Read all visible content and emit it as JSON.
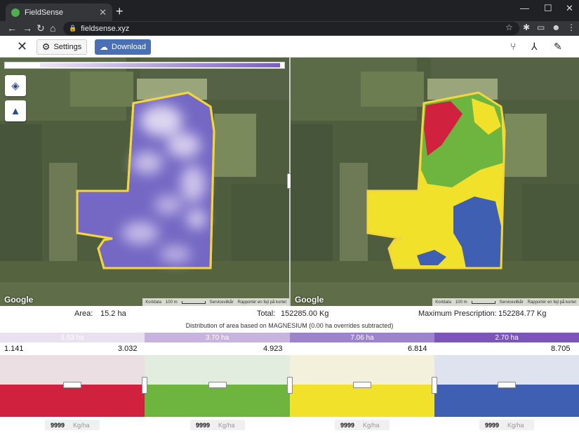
{
  "browser": {
    "tab_title": "FieldSense",
    "tab_close": "✕",
    "new_tab": "+",
    "url": "fieldsense.xyz",
    "win_min": "—",
    "win_max": "☐",
    "win_close": "✕"
  },
  "toolbar": {
    "close": "✕",
    "settings_label": "Settings",
    "download_label": "Download"
  },
  "map": {
    "google_label": "Google",
    "attribution_left": [
      "Kortdata",
      "100 m",
      "Servicevilkår",
      "Rapportér en fejl på kortet"
    ],
    "attribution_right": [
      "Kortdata",
      "100 m",
      "Servicevilkår",
      "Rapportér en fejl på kortet"
    ]
  },
  "stats": {
    "area_label": "Area:",
    "area_value": "15.2 ha",
    "total_label": "Total:",
    "total_value": "152285.00 Kg",
    "max_label": "Maximum Prescription:",
    "max_value": "152284.77 Kg"
  },
  "distribution": {
    "title": "Distribution of area based on MAGNESIUM (0.00 ha overrides subtracted)",
    "classes": [
      {
        "area": "1.63 ha",
        "color": "#e9e0f0",
        "text_color": "#ffffff",
        "top_color": "#ecdfe3",
        "bottom_color": "#d0213f",
        "qty": "9999",
        "unit": "Kg/ha"
      },
      {
        "area": "3.70 ha",
        "color": "#c7b3dd",
        "text_color": "#ffffff",
        "top_color": "#e2ede0",
        "bottom_color": "#6db53f",
        "qty": "9999",
        "unit": "Kg/ha"
      },
      {
        "area": "7.06 ha",
        "color": "#9d83cc",
        "text_color": "#ffffff",
        "top_color": "#f3f1dc",
        "bottom_color": "#f2e12a",
        "qty": "9999",
        "unit": "Kg/ha"
      },
      {
        "area": "2.70 ha",
        "color": "#7c55b8",
        "text_color": "#ffffff",
        "top_color": "#dfe3ef",
        "bottom_color": "#3e5fb2",
        "qty": "9999",
        "unit": "Kg/ha"
      }
    ],
    "bounds": [
      "1.141",
      "3.032",
      "4.923",
      "6.814",
      "8.705"
    ]
  }
}
